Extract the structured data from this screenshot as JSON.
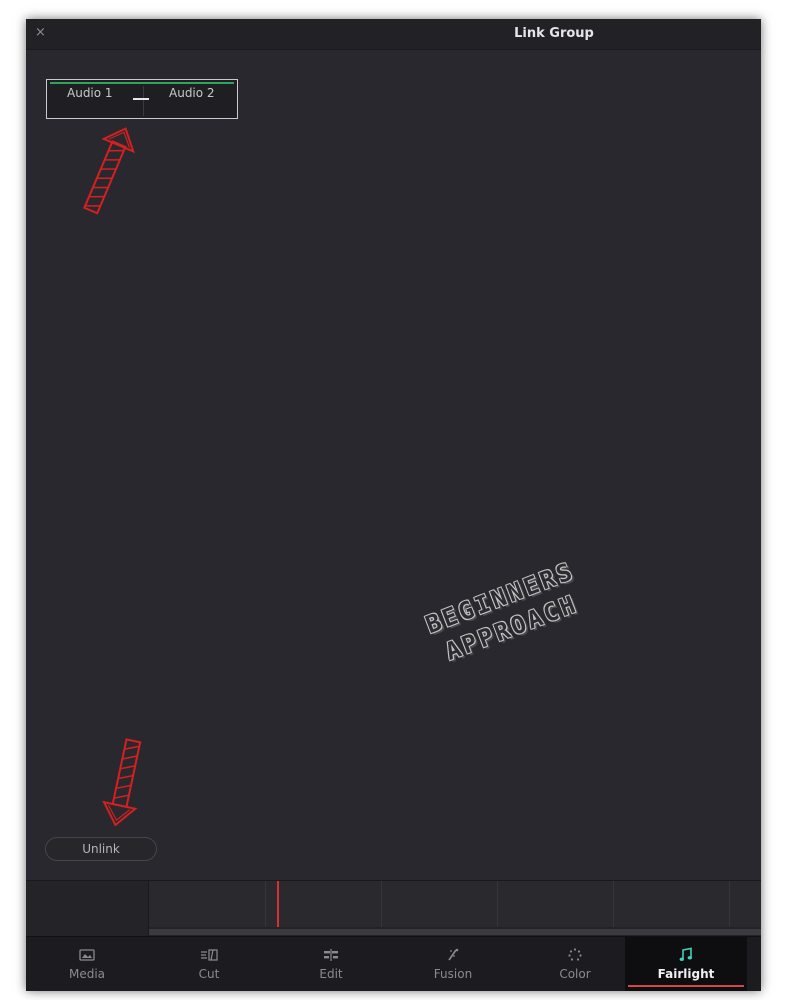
{
  "window": {
    "title": "Link Group",
    "close_glyph": "×"
  },
  "link_group": {
    "channel_1": "Audio 1",
    "channel_2": "Audio 2",
    "link_indicator": "linked"
  },
  "actions": {
    "unlink_label": "Unlink"
  },
  "watermark": {
    "line1": "BEGINNERS",
    "line2": "APPROACH"
  },
  "page_nav": {
    "items": [
      {
        "label": "Media",
        "icon": "media-icon"
      },
      {
        "label": "Cut",
        "icon": "cut-icon"
      },
      {
        "label": "Edit",
        "icon": "edit-icon"
      },
      {
        "label": "Fusion",
        "icon": "fusion-icon"
      },
      {
        "label": "Color",
        "icon": "color-icon"
      },
      {
        "label": "Fairlight",
        "icon": "fairlight-icon"
      }
    ],
    "active": "Fairlight"
  },
  "colors": {
    "accent_red": "#d84545",
    "link_green": "#2fa45a",
    "annotation_red": "#d42020"
  }
}
